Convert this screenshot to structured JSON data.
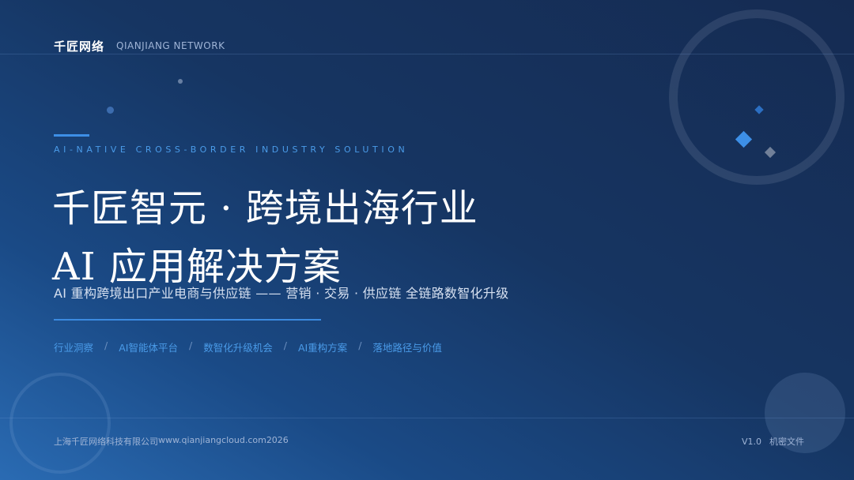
{
  "header": {
    "brand_cn": "千匠网络",
    "brand_en": "QIANJIANG NETWORK"
  },
  "hero": {
    "subtitle_en": "AI-NATIVE CROSS-BORDER INDUSTRY SOLUTION",
    "title_line1": "千匠智元 · 跨境出海行业",
    "title_line2": "AI 应用解决方案",
    "tagline": "AI 重构跨境出口产业电商与供应链 —— 营销 · 交易 · 供应链 全链路数智化升级"
  },
  "nav": {
    "items": [
      "行业洞察",
      "AI智能体平台",
      "数智化升级机会",
      "AI重构方案",
      "落地路径与价值"
    ],
    "separator": "/"
  },
  "footer": {
    "company": "上海千匠网络科技有限公司",
    "website": "www.qianjiangcloud.com",
    "year": "2026",
    "separator": "·",
    "version": "V1.0",
    "classification": "机密文件"
  },
  "colors": {
    "accent": "#3d8fe6",
    "background_dark": "#152b52",
    "background_light": "#2a6bb3",
    "accent_text": "#4a9be8"
  }
}
